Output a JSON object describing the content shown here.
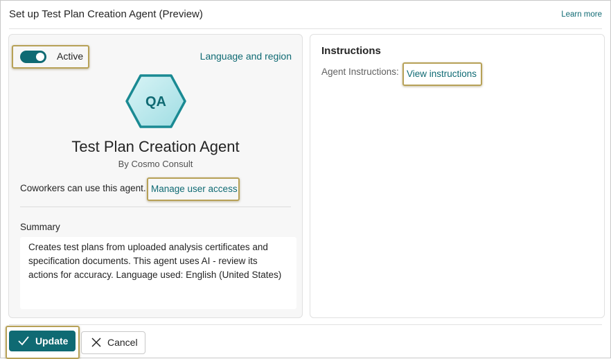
{
  "header": {
    "title": "Set up Test Plan Creation Agent (Preview)",
    "learn_more": "Learn more"
  },
  "agent": {
    "active_label": "Active",
    "active": true,
    "language_link": "Language and region",
    "avatar_initials": "QA",
    "name": "Test Plan Creation Agent",
    "publisher": "By Cosmo Consult",
    "coworkers_text": "Coworkers can use this agent.",
    "manage_access_link": "Manage user access",
    "summary_label": "Summary",
    "summary_text": "Creates test plans from uploaded analysis certificates and specification documents. This agent uses AI - review its actions for accuracy. Language used: English (United States)"
  },
  "instructions": {
    "title": "Instructions",
    "label": "Agent Instructions:",
    "view_link": "View instructions"
  },
  "footer": {
    "update_label": "Update",
    "cancel_label": "Cancel"
  },
  "colors": {
    "accent": "#0f6a73",
    "hex_fill": "#bfe9ec",
    "highlight": "#b7a157"
  },
  "icons": {
    "update": "checkmark-icon",
    "cancel": "close-icon",
    "avatar": "hexagon-icon"
  }
}
